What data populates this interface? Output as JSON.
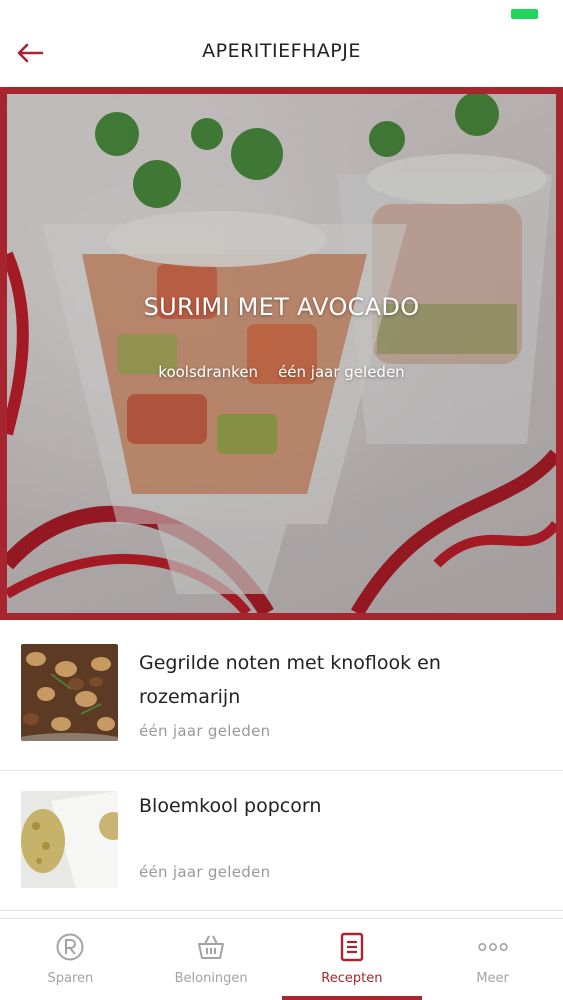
{
  "colors": {
    "accent": "#a7252f",
    "battery": "#20d65c",
    "muted": "#9a9a9a"
  },
  "header": {
    "title": "APERITIEFHAPJE",
    "back_icon": "arrow-left-icon"
  },
  "hero": {
    "title": "SURIMI MET AVOCADO",
    "category": "koolsdranken",
    "time": "één jaar geleden"
  },
  "recipes": [
    {
      "title": "Gegrilde noten met knoflook en rozemarijn",
      "time": "één jaar geleden"
    },
    {
      "title": "Bloemkool popcorn",
      "time": "één jaar geleden"
    }
  ],
  "nav": [
    {
      "label": "Sparen",
      "icon": "savings-r-icon"
    },
    {
      "label": "Beloningen",
      "icon": "basket-icon"
    },
    {
      "label": "Recepten",
      "icon": "recipe-document-icon",
      "active": true
    },
    {
      "label": "Meer",
      "icon": "more-dots-icon"
    }
  ]
}
